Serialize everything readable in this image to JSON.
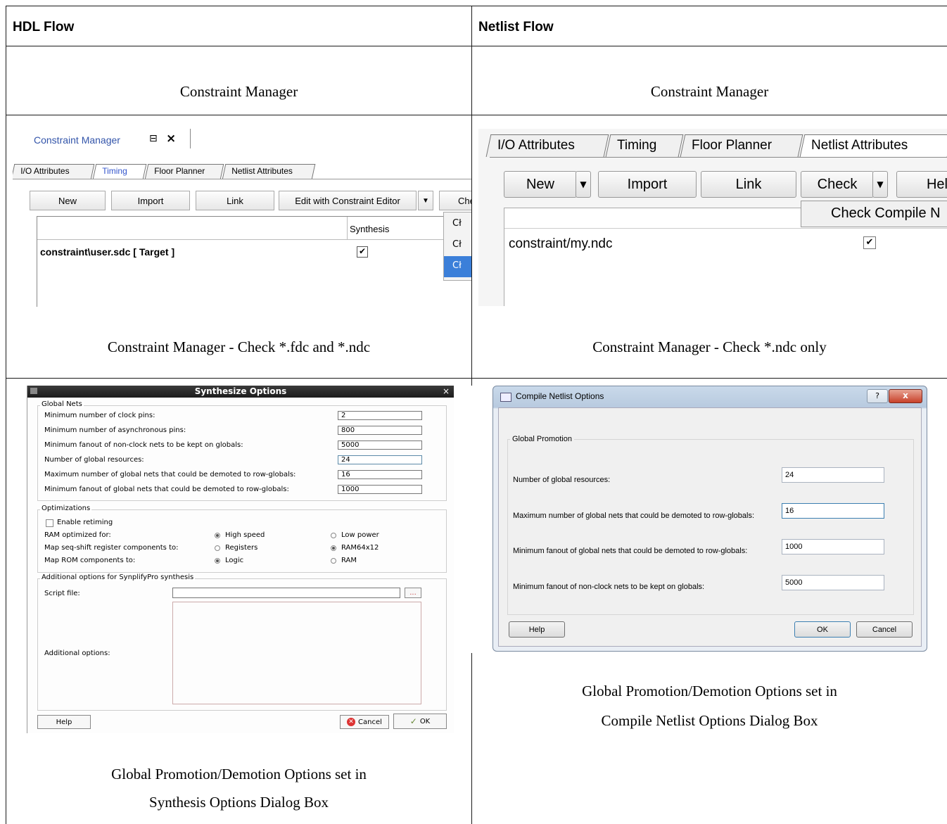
{
  "table": {
    "headers": [
      "HDL Flow",
      "Netlist Flow"
    ],
    "rows": [
      [
        "Constraint Manager",
        "Constraint Manager"
      ],
      [
        "Constraint Manager - Check *.fdc and *.ndc",
        "Constraint Manager - Check *.ndc only"
      ],
      [
        "Global Promotion/Demotion Options set in",
        "Global Promotion/Demotion Options set in"
      ],
      [
        "Synthesis Options Dialog Box",
        "Compile Netlist Options Dialog Box"
      ]
    ]
  },
  "hdl_cm": {
    "panel_title": "Constraint Manager",
    "pin_icon": "pin-icon",
    "close": "×",
    "tabs": [
      "I/O Attributes",
      "Timing",
      "Floor Planner",
      "Netlist Attributes"
    ],
    "buttons": [
      "New",
      "Import",
      "Link",
      "Edit with Constraint Editor",
      "Che"
    ],
    "column": "Synthesis",
    "file": "constraint\\user.sdc  [ Target ]",
    "menu_items": [
      "Cł",
      "Cł",
      "Cł"
    ]
  },
  "net_cm": {
    "tabs": [
      "I/O Attributes",
      "Timing",
      "Floor Planner",
      "Netlist Attributes"
    ],
    "buttons": [
      "New",
      "Import",
      "Link",
      "Check",
      "Hel"
    ],
    "menu_item": "Check Compile N",
    "file": "constraint/my.ndc"
  },
  "synth": {
    "title": "Synthesize Options",
    "global_nets": "Global Nets",
    "fields": [
      {
        "label": "Minimum number of clock pins:",
        "value": "2"
      },
      {
        "label": "Minimum number of asynchronous pins:",
        "value": "800"
      },
      {
        "label": "Minimum fanout of non-clock nets to be kept on globals:",
        "value": "5000"
      },
      {
        "label": "Number of global resources:",
        "value": "24"
      },
      {
        "label": "Maximum number of global nets that could be demoted to row-globals:",
        "value": "16"
      },
      {
        "label": "Minimum fanout of global nets that could be demoted to row-globals:",
        "value": "1000"
      }
    ],
    "optimizations": "Optimizations",
    "retiming": "Enable retiming",
    "ram_opt": {
      "label": "RAM optimized for:",
      "a": "High speed",
      "b": "Low power"
    },
    "seq_shift": {
      "label": "Map seq-shift register components to:",
      "a": "Registers",
      "b": "RAM64x12"
    },
    "rom": {
      "label": "Map ROM components to:",
      "a": "Logic",
      "b": "RAM"
    },
    "additional_group": "Additional options for SynplifyPro synthesis",
    "script_file": "Script file:",
    "browse": "...",
    "additional_options": "Additional options:",
    "help": "Help",
    "cancel": "Cancel",
    "ok": "OK"
  },
  "compile": {
    "title": "Compile Netlist Options",
    "help_glyph": "?",
    "close": "x",
    "group": "Global Promotion",
    "fields": [
      {
        "label": "Number of global resources:",
        "value": "24"
      },
      {
        "label": "Maximum number of global nets that could be demoted to row-globals:",
        "value": "16"
      },
      {
        "label": "Minimum fanout of global nets that could be demoted to row-globals:",
        "value": "1000"
      },
      {
        "label": "Minimum fanout of non-clock nets to be kept on globals:",
        "value": "5000"
      }
    ],
    "help": "Help",
    "ok": "OK",
    "cancel": "Cancel"
  }
}
